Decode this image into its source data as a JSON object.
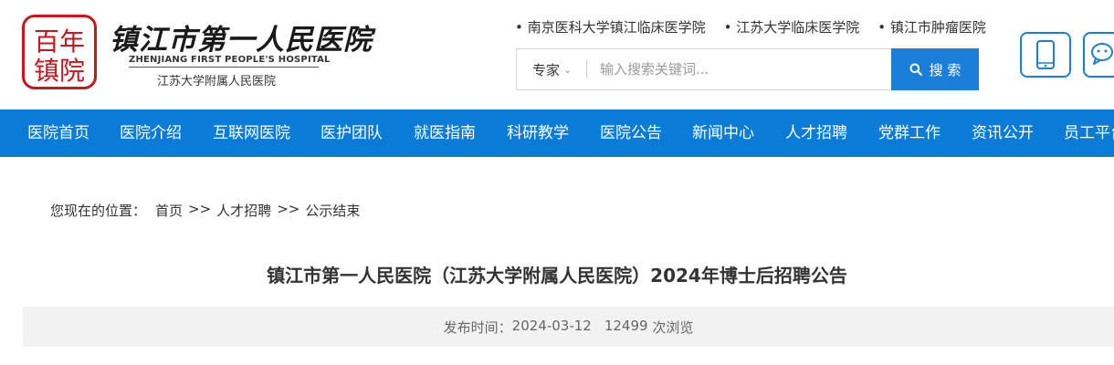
{
  "header": {
    "logo_seal_text": "百年镇院",
    "logo_cn": "镇江市第一人民医院",
    "logo_en": "ZHENJIANG FIRST PEOPLE'S HOSPITAL",
    "logo_sub": "江苏大学附属人民医院",
    "brand_color": "#c8161d",
    "partner_links": [
      "• 南京医科大学镇江临床医学院",
      "• 江苏大学临床医学院",
      "• 镇江市肿瘤医院"
    ],
    "search": {
      "category": "专家",
      "placeholder": "输入搜索关键词...",
      "button_label": "搜 索"
    },
    "mobile_icon": "mobile-phone-icon",
    "wechat_icon": "wechat-icon"
  },
  "nav": {
    "color": "#0a7bd6",
    "items": [
      "医院首页",
      "医院介绍",
      "互联网医院",
      "医护团队",
      "就医指南",
      "科研教学",
      "医院公告",
      "新闻中心",
      "人才招聘",
      "党群工作",
      "资讯公开",
      "员工平台"
    ]
  },
  "breadcrumb": {
    "prefix": "您现在的位置：",
    "items": [
      "首页",
      "人才招聘",
      "公示结束"
    ],
    "separator": ">>"
  },
  "article": {
    "title": "镇江市第一人民医院（江苏大学附属人民医院）2024年博士后招聘公告",
    "publish_label": "发布时间：",
    "publish_date": "2024-03-12",
    "views": "12499",
    "views_label": "次浏览"
  }
}
